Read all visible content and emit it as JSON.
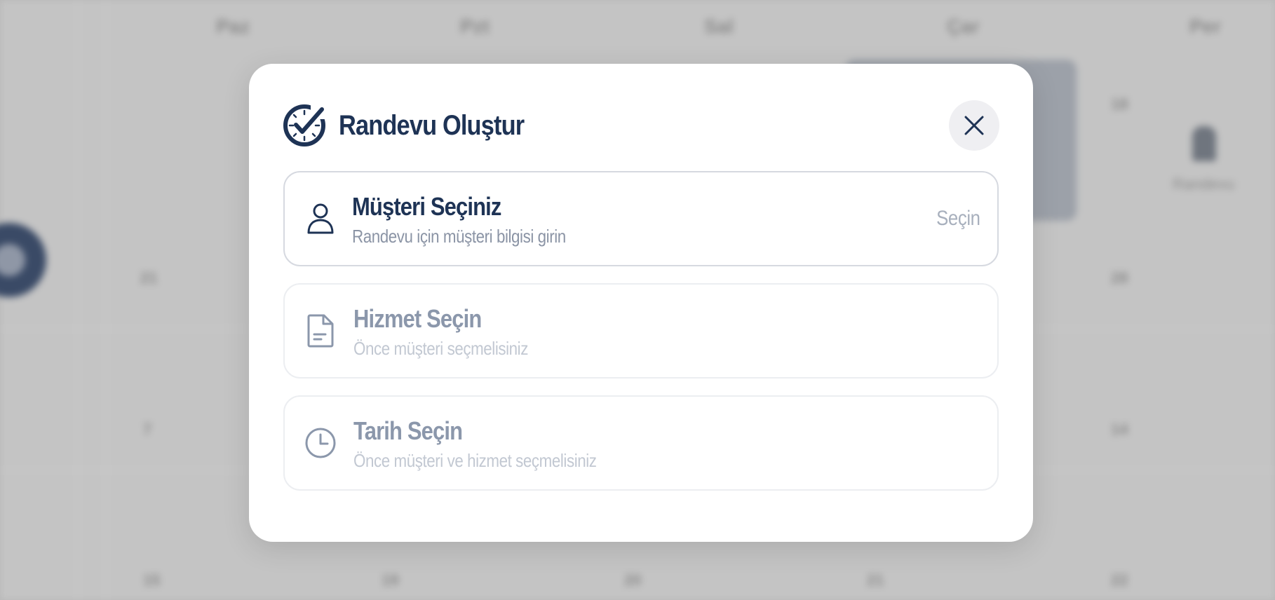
{
  "background": {
    "weekdays": [
      "Paz",
      "Pzt",
      "Sal",
      "Çar",
      "Per"
    ],
    "dates": [
      "18",
      "21",
      "28",
      "7",
      "14",
      "15",
      "19",
      "20",
      "21",
      "22"
    ],
    "caption": "Randevu"
  },
  "modal": {
    "title": "Randevu Oluştur",
    "header_icon": "clock-check-icon",
    "close_icon": "close-icon",
    "steps": [
      {
        "icon": "user-icon",
        "title": "Müşteri Seçiniz",
        "subtitle": "Randevu için müşteri bilgisi girin",
        "action": "Seçin",
        "enabled": true
      },
      {
        "icon": "document-icon",
        "title": "Hizmet Seçin",
        "subtitle": "Önce müşteri seçmelisiniz",
        "enabled": false
      },
      {
        "icon": "clock-icon",
        "title": "Tarih Seçin",
        "subtitle": "Önce müşteri ve hizmet seçmelisiniz",
        "enabled": false
      }
    ]
  },
  "colors": {
    "primary": "#1e3355",
    "muted": "#8b97ab",
    "disabled_text": "#c2c8d2",
    "border": "#e3e5ea",
    "close_bg": "#efeff2"
  }
}
